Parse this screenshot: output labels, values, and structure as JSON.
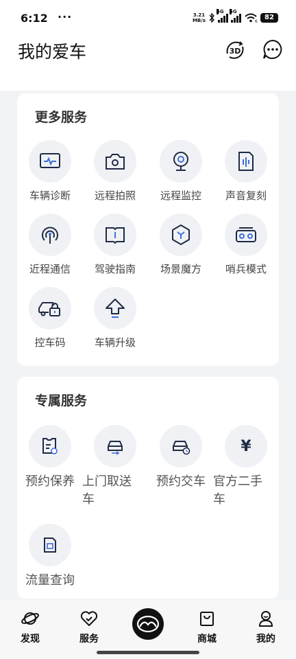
{
  "status_bar": {
    "time": "6:12",
    "dots": "···",
    "net_speed_value": "3.21",
    "net_speed_unit": "MB/s",
    "signal_1_label": "5G",
    "signal_2_label": "5G",
    "wifi_label": "6",
    "battery": "82"
  },
  "header": {
    "title": "我的爱车",
    "btn_3d_label": "3D"
  },
  "more_services": {
    "title": "更多服务",
    "items": [
      {
        "label": "车辆诊断",
        "icon": "diagnostic-monitor-icon"
      },
      {
        "label": "远程拍照",
        "icon": "camera-icon"
      },
      {
        "label": "远程监控",
        "icon": "webcam-icon"
      },
      {
        "label": "声音复刻",
        "icon": "voice-card-icon"
      },
      {
        "label": "近程通信",
        "icon": "signal-broadcast-icon"
      },
      {
        "label": "驾驶指南",
        "icon": "book-icon"
      },
      {
        "label": "场景魔方",
        "icon": "hexagon-cube-icon"
      },
      {
        "label": "哨兵模式",
        "icon": "vr-sentinel-icon"
      },
      {
        "label": "控车码",
        "icon": "car-lock-icon"
      },
      {
        "label": "车辆升级",
        "icon": "upgrade-arrow-icon"
      }
    ]
  },
  "exclusive_services": {
    "title": "专属服务",
    "items": [
      {
        "label": "预约保养",
        "icon": "maintenance-checklist-icon"
      },
      {
        "label": "上门取送车",
        "icon": "car-pickup-icon"
      },
      {
        "label": "预约交车",
        "icon": "car-delivery-icon"
      },
      {
        "label": "官方二手车",
        "icon": "yen-icon",
        "glyph": "¥"
      },
      {
        "label": "流量查询",
        "icon": "sim-card-icon"
      }
    ]
  },
  "bottom_nav": {
    "items": [
      {
        "label": "发现",
        "icon": "planet-icon"
      },
      {
        "label": "服务",
        "icon": "heart-service-icon"
      },
      {
        "label": "商城",
        "icon": "shopping-bag-icon"
      },
      {
        "label": "我的",
        "icon": "profile-icon"
      }
    ],
    "center_icon": "brand-logo-icon"
  },
  "colors": {
    "icon_stroke": "#1f2a44",
    "accent_blue": "#3f6fd8"
  }
}
